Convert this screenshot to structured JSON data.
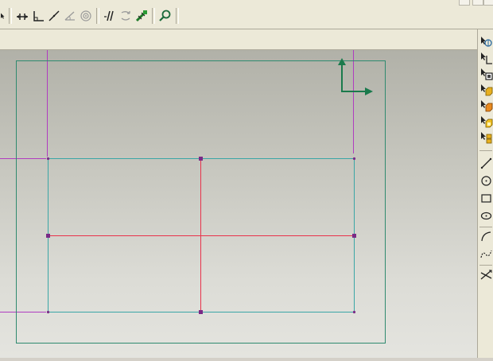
{
  "top_toolbar": {
    "tools": [
      {
        "name": "cursor-icon"
      },
      {
        "name": "horizontal-constraint-icon"
      },
      {
        "name": "perpendicular-constraint-icon"
      },
      {
        "name": "line-icon"
      },
      {
        "name": "angle-icon"
      },
      {
        "name": "concentric-icon"
      },
      {
        "name": "parallel-icon"
      },
      {
        "name": "mirror-icon"
      },
      {
        "name": "dimension-icon"
      },
      {
        "name": "zoom-icon"
      }
    ]
  },
  "right_toolbar": {
    "tools": [
      {
        "name": "rotate-view-icon"
      },
      {
        "name": "sketch-plane-icon"
      },
      {
        "name": "select-face-icon"
      },
      {
        "name": "extrude-icon"
      },
      {
        "name": "revolve-icon"
      },
      {
        "name": "shell-icon"
      },
      {
        "name": "pattern-icon"
      },
      {
        "name": "line-tool-icon"
      },
      {
        "name": "circle-tool-icon"
      },
      {
        "name": "rectangle-tool-icon"
      },
      {
        "name": "ellipse-tool-icon"
      },
      {
        "name": "arc-tool-icon"
      },
      {
        "name": "spline-tool-icon"
      },
      {
        "name": "trim-tool-icon"
      }
    ]
  },
  "colors": {
    "frame": "#2f8a6f",
    "rectangle": "#3aa6a6",
    "centerline": "#e8324b",
    "reference": "#b03cc0",
    "vertex": "#7a2a86",
    "axis": "#1a7a4c"
  }
}
